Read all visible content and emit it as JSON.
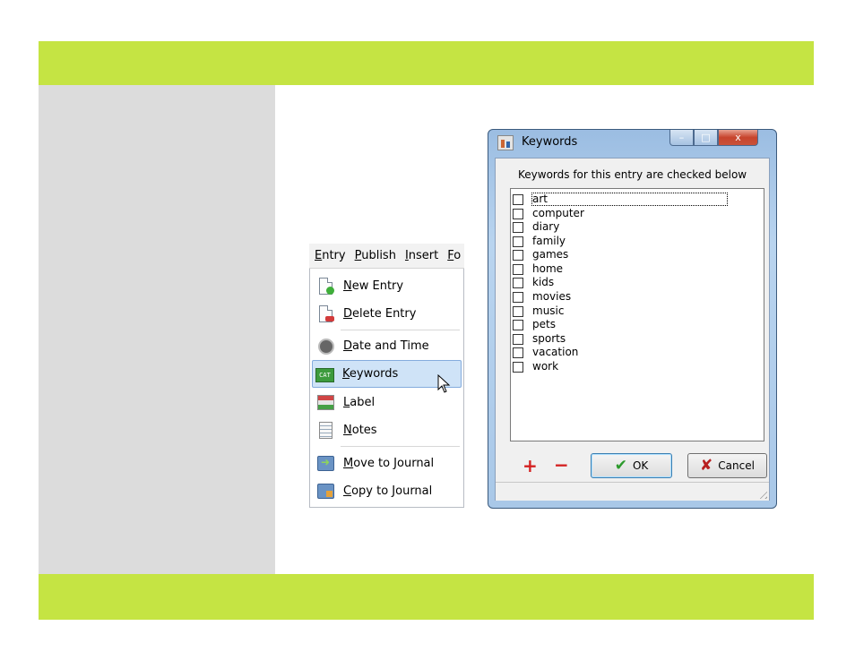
{
  "menu": {
    "menubar": [
      "Entry",
      "Publish",
      "Insert",
      "Fo"
    ],
    "items": [
      {
        "label": "New Entry",
        "icon": "new-entry-icon"
      },
      {
        "label": "Delete Entry",
        "icon": "delete-entry-icon"
      },
      {
        "label": "Date and Time",
        "icon": "clock-icon"
      },
      {
        "label": "Keywords",
        "icon": "keywords-icon",
        "highlighted": true
      },
      {
        "label": "Label",
        "icon": "label-icon"
      },
      {
        "label": "Notes",
        "icon": "notes-icon"
      },
      {
        "label": "Move to Journal",
        "icon": "move-journal-icon"
      },
      {
        "label": "Copy to Journal",
        "icon": "copy-journal-icon"
      }
    ],
    "keywords_icon_text": "CAT"
  },
  "dialog": {
    "title": "Keywords",
    "caption": "Keywords for this entry are checked below",
    "keywords": [
      "art",
      "computer",
      "diary",
      "family",
      "games",
      "home",
      "kids",
      "movies",
      "music",
      "pets",
      "sports",
      "vacation",
      "work"
    ],
    "add_label": "+",
    "remove_label": "−",
    "ok_label": "OK",
    "cancel_label": "Cancel",
    "window_buttons": {
      "min": "–",
      "max": "□",
      "close": "x"
    }
  },
  "colors": {
    "accent_band": "#c5e443",
    "sidebar": "#dcdcdc",
    "menu_highlight": "#cfe3f7"
  }
}
